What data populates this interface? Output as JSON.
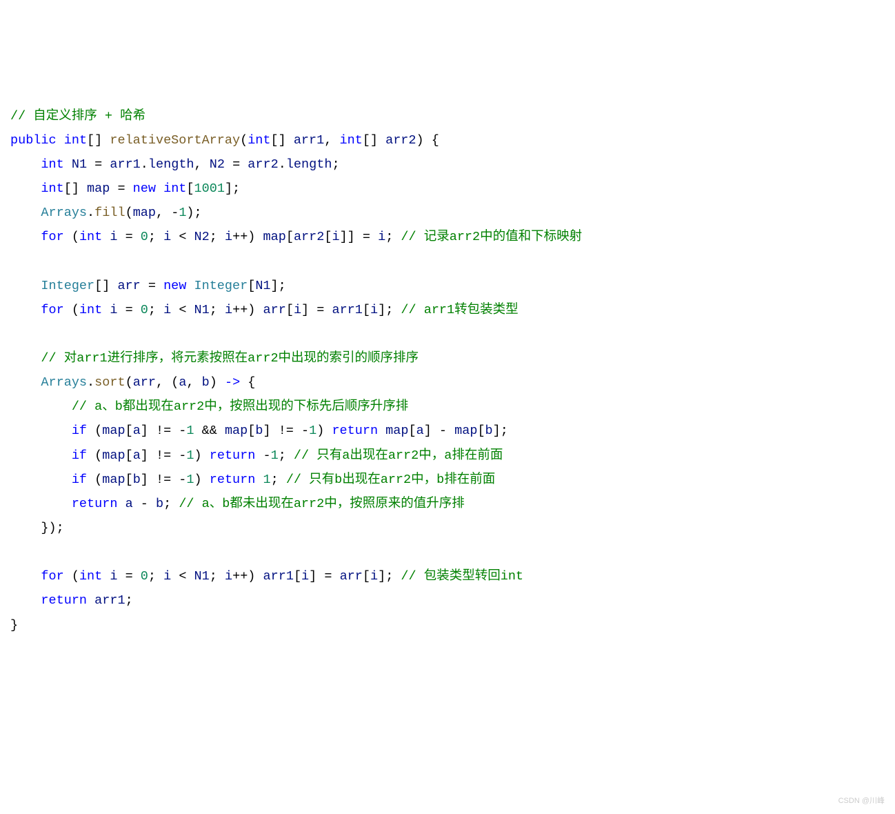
{
  "code": {
    "c1": "// 自定义排序 + 哈希",
    "kw_public": "public",
    "kw_int": "int",
    "fn_name": "relativeSortArray",
    "p_arr1": "arr1",
    "p_arr2": "arr2",
    "v_N1": "N1",
    "v_N2": "N2",
    "m_length": "length",
    "v_map": "map",
    "kw_new": "new",
    "n_1001": "1001",
    "cls_Arrays": "Arrays",
    "m_fill": "fill",
    "n_m1": "-1",
    "kw_for": "for",
    "v_i": "i",
    "n_0": "0",
    "c2": "// 记录arr2中的值和下标映射",
    "cls_Integer": "Integer",
    "v_arr": "arr",
    "c3": "// arr1转包装类型",
    "c4": "// 对arr1进行排序，将元素按照在arr2中出现的索引的顺序排序",
    "m_sort": "sort",
    "v_a": "a",
    "v_b": "b",
    "c5": "// a、b都出现在arr2中，按照出现的下标先后顺序升序排",
    "kw_if": "if",
    "kw_return": "return",
    "c6": "// 只有a出现在arr2中，a排在前面",
    "n_1": "1",
    "c7": "// 只有b出现在arr2中，b排在前面",
    "c8": "// a、b都未出现在arr2中，按照原来的值升序排",
    "c9": "// 包装类型转回int"
  },
  "watermark": "CSDN @川峰"
}
